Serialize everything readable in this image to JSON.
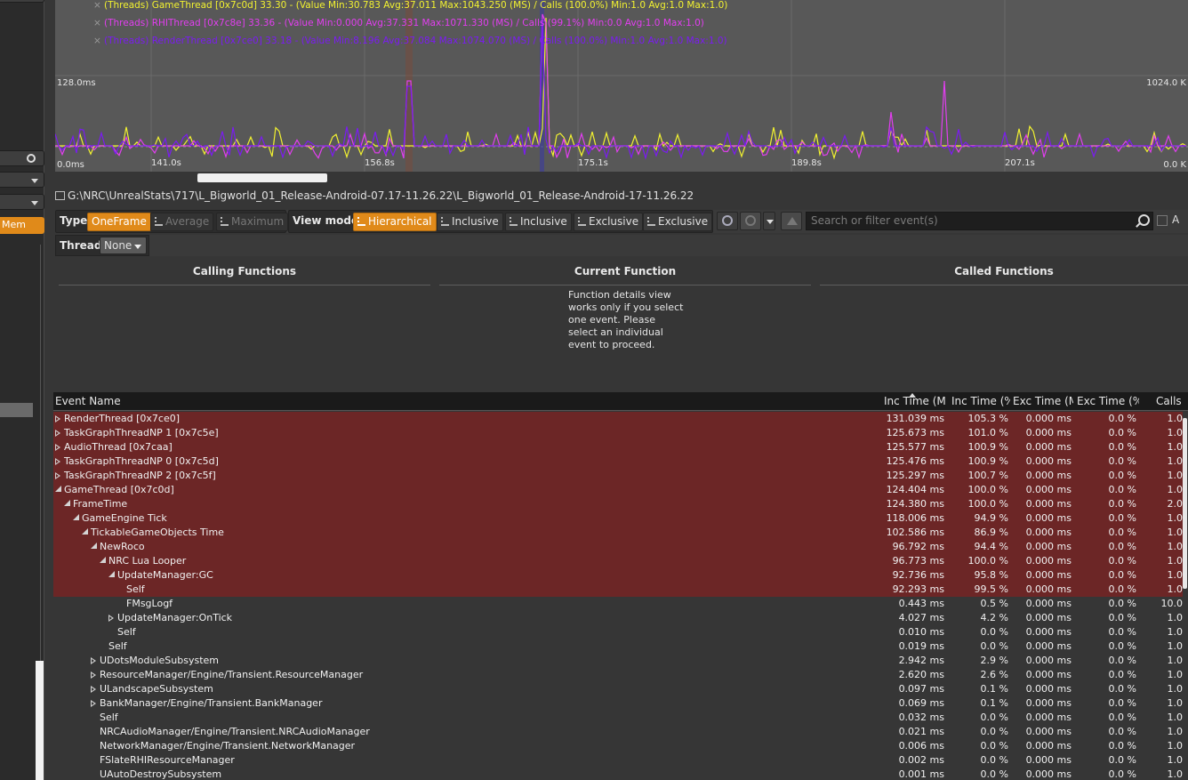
{
  "graph": {
    "legend": [
      {
        "text": "(Threads) GameThread [0x7c0d] 33.30 - (Value Min:30.783 Avg:37.011 Max:1043.250 (MS) / Calls (100.0%) Min:1.0 Avg:1.0 Max:1.0)",
        "color": "#f2f230"
      },
      {
        "text": "(Threads) RHIThread [0x7c8e] 33.36 - (Value Min:0.000 Avg:37.331 Max:1071.330 (MS) / Calls (99.1%) Min:0.0 Avg:1.0 Max:1.0)",
        "color": "#e23ef0"
      },
      {
        "text": "(Threads) RenderThread [0x7ce0] 33.18 - (Value Min:8.196 Avg:37.084 Max:1074.070 (MS) / Calls (100.0%) Min:1.0 Avg:1.0 Max:1.0)",
        "color": "#7b1bf2"
      }
    ],
    "y_left_top": "128.0ms",
    "y_left_bottom": "0.0ms",
    "y_right_top": "1024.0 K",
    "y_right_bottom": "0.0 K",
    "x_ticks": [
      "141.0s",
      "156.8s",
      "175.1s",
      "189.8s",
      "207.1s"
    ]
  },
  "path": "G:\\NRC\\UnrealStats\\717\\L_Bigworld_01_Release-Android-07.17-11.26.22\\L_Bigworld_01_Release-Android-17-11.26.22",
  "toolbar": {
    "type_label": "Type",
    "oneframe": "OneFrame",
    "average": "Average",
    "maximum": "Maximum",
    "viewmode_label": "View mode",
    "hierarchical": "Hierarchical",
    "inclusive1": "Inclusive",
    "inclusive2": "Inclusive",
    "exclusive1": "Exclusive",
    "exclusive2": "Exclusive",
    "search_placeholder": "Search or filter event(s)",
    "trailing": "A"
  },
  "thread": {
    "label": "Thread",
    "value": "None"
  },
  "function_details": {
    "calling": "Calling Functions",
    "current": "Current Function",
    "called": "Called Functions",
    "message": "Function details view works only if you select one event. Please select an individual event to proceed."
  },
  "table": {
    "columns": [
      "Event Name",
      "Inc Time (MS",
      "Inc Time (%)",
      "Exc Time (MS",
      "Exc Time (%)",
      "Calls"
    ],
    "rows": [
      {
        "name": "RenderThread [0x7ce0]",
        "depth": 0,
        "exp": "c",
        "hl": true,
        "inc": "131.039 ms",
        "incp": "105.3 %",
        "exc": "0.000 ms",
        "excp": "0.0 %",
        "calls": "1.0"
      },
      {
        "name": "TaskGraphThreadNP 1 [0x7c5e]",
        "depth": 0,
        "exp": "c",
        "hl": true,
        "inc": "125.673 ms",
        "incp": "101.0 %",
        "exc": "0.000 ms",
        "excp": "0.0 %",
        "calls": "1.0"
      },
      {
        "name": "AudioThread [0x7caa]",
        "depth": 0,
        "exp": "c",
        "hl": true,
        "inc": "125.577 ms",
        "incp": "100.9 %",
        "exc": "0.000 ms",
        "excp": "0.0 %",
        "calls": "1.0"
      },
      {
        "name": "TaskGraphThreadNP 0 [0x7c5d]",
        "depth": 0,
        "exp": "c",
        "hl": true,
        "inc": "125.476 ms",
        "incp": "100.9 %",
        "exc": "0.000 ms",
        "excp": "0.0 %",
        "calls": "1.0"
      },
      {
        "name": "TaskGraphThreadNP 2 [0x7c5f]",
        "depth": 0,
        "exp": "c",
        "hl": true,
        "inc": "125.297 ms",
        "incp": "100.7 %",
        "exc": "0.000 ms",
        "excp": "0.0 %",
        "calls": "1.0"
      },
      {
        "name": "GameThread [0x7c0d]",
        "depth": 0,
        "exp": "o",
        "hl": true,
        "inc": "124.404 ms",
        "incp": "100.0 %",
        "exc": "0.000 ms",
        "excp": "0.0 %",
        "calls": "1.0"
      },
      {
        "name": "FrameTime",
        "depth": 1,
        "exp": "o",
        "hl": true,
        "inc": "124.380 ms",
        "incp": "100.0 %",
        "exc": "0.000 ms",
        "excp": "0.0 %",
        "calls": "2.0"
      },
      {
        "name": "GameEngine Tick",
        "depth": 2,
        "exp": "o",
        "hl": true,
        "inc": "118.006 ms",
        "incp": "94.9 %",
        "exc": "0.000 ms",
        "excp": "0.0 %",
        "calls": "1.0"
      },
      {
        "name": "TickableGameObjects Time",
        "depth": 3,
        "exp": "o",
        "hl": true,
        "inc": "102.586 ms",
        "incp": "86.9 %",
        "exc": "0.000 ms",
        "excp": "0.0 %",
        "calls": "1.0"
      },
      {
        "name": "NewRoco",
        "depth": 4,
        "exp": "o",
        "hl": true,
        "inc": "96.792 ms",
        "incp": "94.4 %",
        "exc": "0.000 ms",
        "excp": "0.0 %",
        "calls": "1.0"
      },
      {
        "name": "NRC Lua Looper",
        "depth": 5,
        "exp": "o",
        "hl": true,
        "inc": "96.773 ms",
        "incp": "100.0 %",
        "exc": "0.000 ms",
        "excp": "0.0 %",
        "calls": "1.0"
      },
      {
        "name": "UpdateManager:GC",
        "depth": 6,
        "exp": "o",
        "hl": true,
        "inc": "92.736 ms",
        "incp": "95.8 %",
        "exc": "0.000 ms",
        "excp": "0.0 %",
        "calls": "1.0"
      },
      {
        "name": "Self",
        "depth": 7,
        "exp": "",
        "hl": true,
        "inc": "92.293 ms",
        "incp": "99.5 %",
        "exc": "0.000 ms",
        "excp": "0.0 %",
        "calls": "1.0"
      },
      {
        "name": "FMsgLogf",
        "depth": 7,
        "exp": "",
        "hl": false,
        "inc": "0.443 ms",
        "incp": "0.5 %",
        "exc": "0.000 ms",
        "excp": "0.0 %",
        "calls": "10.0"
      },
      {
        "name": "UpdateManager:OnTick",
        "depth": 6,
        "exp": "c",
        "hl": false,
        "inc": "4.027 ms",
        "incp": "4.2 %",
        "exc": "0.000 ms",
        "excp": "0.0 %",
        "calls": "1.0"
      },
      {
        "name": "Self",
        "depth": 6,
        "exp": "",
        "hl": false,
        "inc": "0.010 ms",
        "incp": "0.0 %",
        "exc": "0.000 ms",
        "excp": "0.0 %",
        "calls": "1.0"
      },
      {
        "name": "Self",
        "depth": 5,
        "exp": "",
        "hl": false,
        "inc": "0.019 ms",
        "incp": "0.0 %",
        "exc": "0.000 ms",
        "excp": "0.0 %",
        "calls": "1.0"
      },
      {
        "name": "UDotsModuleSubsystem",
        "depth": 4,
        "exp": "c",
        "hl": false,
        "inc": "2.942 ms",
        "incp": "2.9 %",
        "exc": "0.000 ms",
        "excp": "0.0 %",
        "calls": "1.0"
      },
      {
        "name": "ResourceManager/Engine/Transient.ResourceManager",
        "depth": 4,
        "exp": "c",
        "hl": false,
        "inc": "2.620 ms",
        "incp": "2.6 %",
        "exc": "0.000 ms",
        "excp": "0.0 %",
        "calls": "1.0"
      },
      {
        "name": "ULandscapeSubsystem",
        "depth": 4,
        "exp": "c",
        "hl": false,
        "inc": "0.097 ms",
        "incp": "0.1 %",
        "exc": "0.000 ms",
        "excp": "0.0 %",
        "calls": "1.0"
      },
      {
        "name": "BankManager/Engine/Transient.BankManager",
        "depth": 4,
        "exp": "c",
        "hl": false,
        "inc": "0.069 ms",
        "incp": "0.1 %",
        "exc": "0.000 ms",
        "excp": "0.0 %",
        "calls": "1.0"
      },
      {
        "name": "Self",
        "depth": 4,
        "exp": "",
        "hl": false,
        "inc": "0.032 ms",
        "incp": "0.0 %",
        "exc": "0.000 ms",
        "excp": "0.0 %",
        "calls": "1.0"
      },
      {
        "name": "NRCAudioManager/Engine/Transient.NRCAudioManager",
        "depth": 4,
        "exp": "",
        "hl": false,
        "inc": "0.021 ms",
        "incp": "0.0 %",
        "exc": "0.000 ms",
        "excp": "0.0 %",
        "calls": "1.0"
      },
      {
        "name": "NetworkManager/Engine/Transient.NetworkManager",
        "depth": 4,
        "exp": "",
        "hl": false,
        "inc": "0.006 ms",
        "incp": "0.0 %",
        "exc": "0.000 ms",
        "excp": "0.0 %",
        "calls": "1.0"
      },
      {
        "name": "FSlateRHIResourceManager",
        "depth": 4,
        "exp": "",
        "hl": false,
        "inc": "0.002 ms",
        "incp": "0.0 %",
        "exc": "0.000 ms",
        "excp": "0.0 %",
        "calls": "1.0"
      },
      {
        "name": "UAutoDestroySubsystem",
        "depth": 4,
        "exp": "",
        "hl": false,
        "inc": "0.001 ms",
        "incp": "0.0 %",
        "exc": "0.000 ms",
        "excp": "0.0 %",
        "calls": "1.0"
      }
    ]
  },
  "left_panel": {
    "mem_label": "Mem"
  }
}
